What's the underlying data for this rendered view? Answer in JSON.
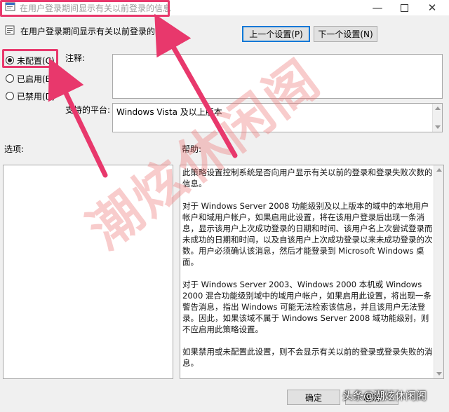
{
  "window": {
    "title": "在用户登录期间显示有关以前登录的信息"
  },
  "header": {
    "setting_name": "在用户登录期间显示有关以前登录的信息",
    "prev_button": "上一个设置(P)",
    "next_button": "下一个设置(N)"
  },
  "state_options": [
    {
      "label": "未配置(C)",
      "selected": true
    },
    {
      "label": "已启用(E)",
      "selected": false
    },
    {
      "label": "已禁用(D)",
      "selected": false
    }
  ],
  "fields": {
    "comment_label": "注释:",
    "comment_value": "",
    "platform_label": "支持的平台:",
    "platform_value": "Windows Vista 及以上版本"
  },
  "sections": {
    "options_label": "选项:",
    "help_label": "帮助:"
  },
  "help_paragraphs": [
    "此策略设置控制系统是否向用户显示有关以前的登录和登录失败次数的信息。",
    "对于 Windows Server 2008 功能级别及以上版本的域中的本地用户帐户和域用户帐户，如果启用此设置，将在该用户登录后出现一条消息，显示该用户上次成功登录的日期和时间、该用户名上次尝试登录而未成功的日期和时间，以及自该用户上次成功登录以来未成功登录的次数。用户必须确认该消息，然后才能登录到 Microsoft Windows 桌面。",
    "对于 Windows Server 2003、Windows 2000 本机或 Windows 2000 混合功能级别域中的域用户帐户，如果启用此设置，将出现一条警告消息，指出 Windows 可能无法检索该信息，并且该用户无法登录。因此，如果该域不属于 Windows Server 2008 域功能级别，则不应启用此策略设置。",
    "如果禁用或未配置此设置，则不会显示有关以前的登录或登录失败的消息。"
  ],
  "footer": {
    "ok_button": "确定",
    "cancel_button": "取消"
  },
  "watermark": {
    "large": "潮炫休闲阁",
    "corner": "头条@潮炫休闲阁"
  },
  "colors": {
    "highlight": "#e8386c",
    "focus_border": "#0078d7",
    "window_bg": "#f0f0f0"
  },
  "icons": {
    "app": "policy-app-icon",
    "setting": "policy-setting-icon",
    "minimize": "minimize-icon",
    "maximize": "maximize-icon",
    "close": "close-icon"
  }
}
